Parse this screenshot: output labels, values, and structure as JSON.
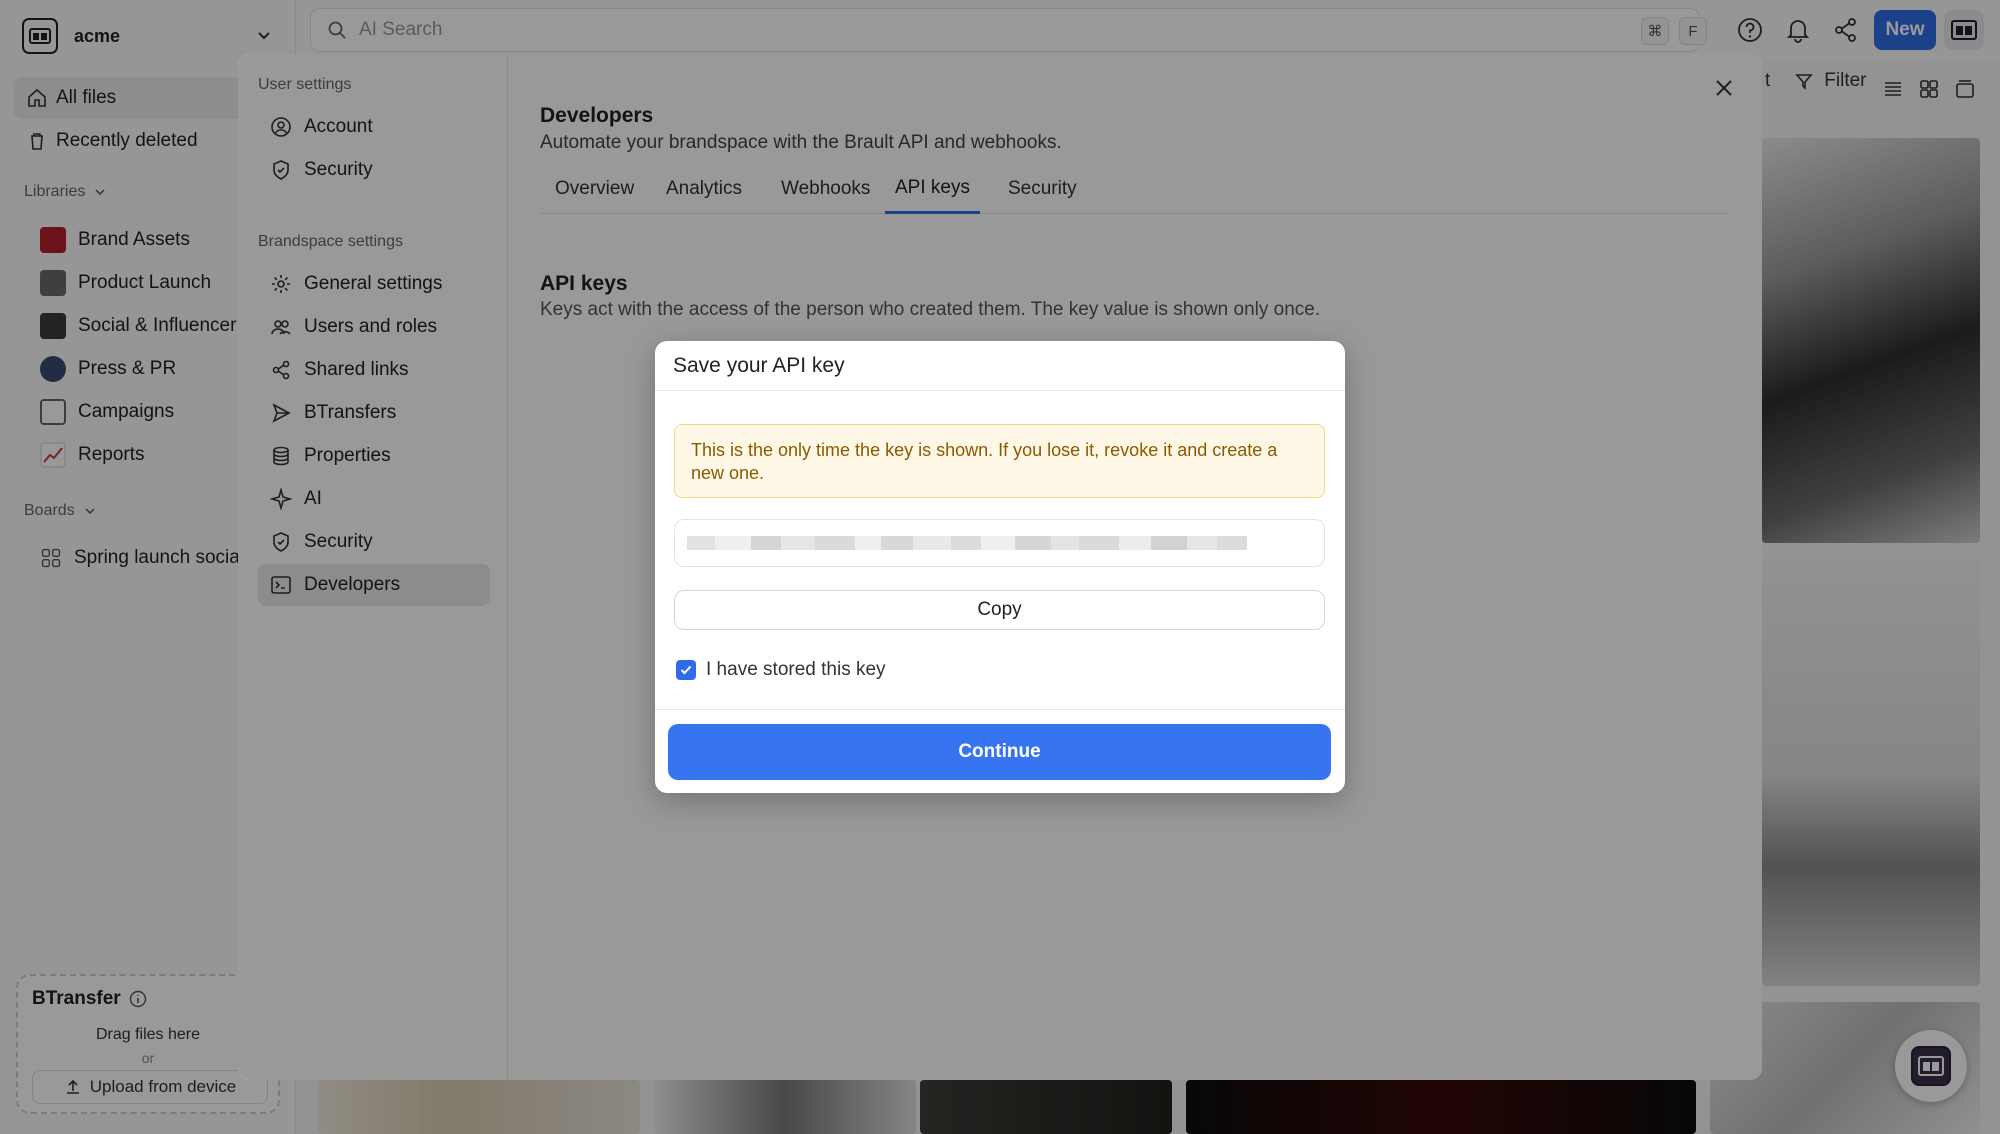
{
  "workspace": {
    "name": "acme"
  },
  "sidebar": {
    "nav": [
      {
        "label": "All files",
        "icon": "home-icon",
        "active": true
      },
      {
        "label": "Recently deleted",
        "icon": "trash-icon",
        "active": false
      }
    ],
    "libraries_label": "Libraries",
    "libraries": [
      {
        "label": "Brand Assets",
        "icon": "book-icon",
        "color": "#b3222a"
      },
      {
        "label": "Product Launch",
        "icon": "folder-icon",
        "color": "#6a6a6a"
      },
      {
        "label": "Social & Influencer",
        "icon": "camera-icon",
        "color": "#3a3a3a"
      },
      {
        "label": "Press & PR",
        "icon": "speech-icon",
        "color": "#3b4a73"
      },
      {
        "label": "Campaigns",
        "icon": "archive-icon",
        "color": "#666666"
      },
      {
        "label": "Reports",
        "icon": "chart-icon",
        "color": "#c83a3a"
      }
    ],
    "boards_label": "Boards",
    "boards": [
      {
        "label": "Spring launch social",
        "icon": "grid-icon"
      }
    ],
    "btransfer": {
      "title": "BTransfer",
      "drag_text": "Drag files here",
      "or_text": "or",
      "upload_label": "Upload from device"
    }
  },
  "topbar": {
    "search_placeholder": "AI Search",
    "kbd_1": "⌘",
    "kbd_2": "F",
    "new_label": "New",
    "filter_label": "Filter",
    "partial_label": "t"
  },
  "settings": {
    "user_settings_label": "User settings",
    "user_items": [
      {
        "label": "Account",
        "icon": "user-circle-icon"
      },
      {
        "label": "Security",
        "icon": "shield-icon"
      }
    ],
    "brandspace_settings_label": "Brandspace settings",
    "brandspace_items": [
      {
        "label": "General settings",
        "icon": "gear-icon"
      },
      {
        "label": "Users and roles",
        "icon": "users-icon"
      },
      {
        "label": "Shared links",
        "icon": "share-icon"
      },
      {
        "label": "BTransfers",
        "icon": "send-icon"
      },
      {
        "label": "Properties",
        "icon": "database-icon"
      },
      {
        "label": "AI",
        "icon": "sparkle-icon"
      },
      {
        "label": "Security",
        "icon": "shield-icon"
      },
      {
        "label": "Developers",
        "icon": "terminal-icon",
        "active": true
      }
    ],
    "page_title": "Developers",
    "page_subtitle": "Automate your brandspace with the Brault API and webhooks.",
    "tabs": [
      {
        "label": "Overview",
        "active": false
      },
      {
        "label": "Analytics",
        "active": false
      },
      {
        "label": "Webhooks",
        "active": false
      },
      {
        "label": "API keys",
        "active": true
      },
      {
        "label": "Security",
        "active": false
      }
    ],
    "section_title": "API keys",
    "section_subtitle": "Keys act with the access of the person who created them. The key value is shown only once."
  },
  "dialog": {
    "title": "Save your API key",
    "warning": "This is the only time the key is shown. If you lose it, revoke it and create a new one.",
    "copy_label": "Copy",
    "checkbox_label": "I have stored this key",
    "checkbox_checked": true,
    "continue_label": "Continue"
  },
  "colors": {
    "accent": "#2f6de8",
    "continue": "#3774ef",
    "warning_bg": "#fff8e6",
    "warning_text": "#8a5a00"
  }
}
